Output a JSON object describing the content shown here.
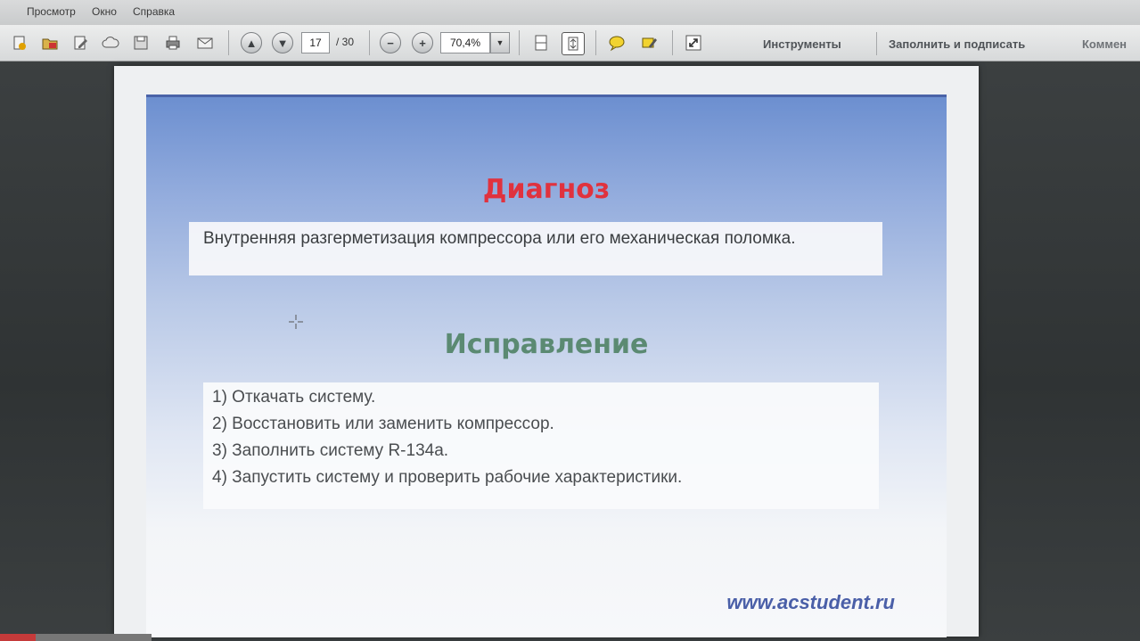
{
  "menu": {
    "items": [
      "Просмотр",
      "Окно",
      "Справка"
    ]
  },
  "toolbar": {
    "icons": [
      "create-icon",
      "open-icon",
      "edit-icon",
      "cloud-icon",
      "save-icon",
      "print-icon",
      "mail-icon"
    ],
    "current_page": "17",
    "total_pages": "/ 30",
    "zoom": "70,4%",
    "tools_label": "Инструменты",
    "fill_sign_label": "Заполнить и подписать",
    "comment_label": "Коммен"
  },
  "slide": {
    "diagnosis_title": "Диагноз",
    "diagnosis_text": "Внутренняя разгерметизация компрессора или его механическая поломка.",
    "fix_title": "Исправление",
    "fix_items": [
      "1) Откачать систему.",
      "2) Восстановить или заменить компрессор.",
      "3) Заполнить систему R-134a.",
      "4) Запустить систему и проверить рабочие характеристики."
    ],
    "footer_url": "www.acstudent.ru"
  },
  "colors": {
    "diagnosis_title": "#e0323e",
    "fix_title": "#5b8a72",
    "url": "#4a5fa8"
  }
}
